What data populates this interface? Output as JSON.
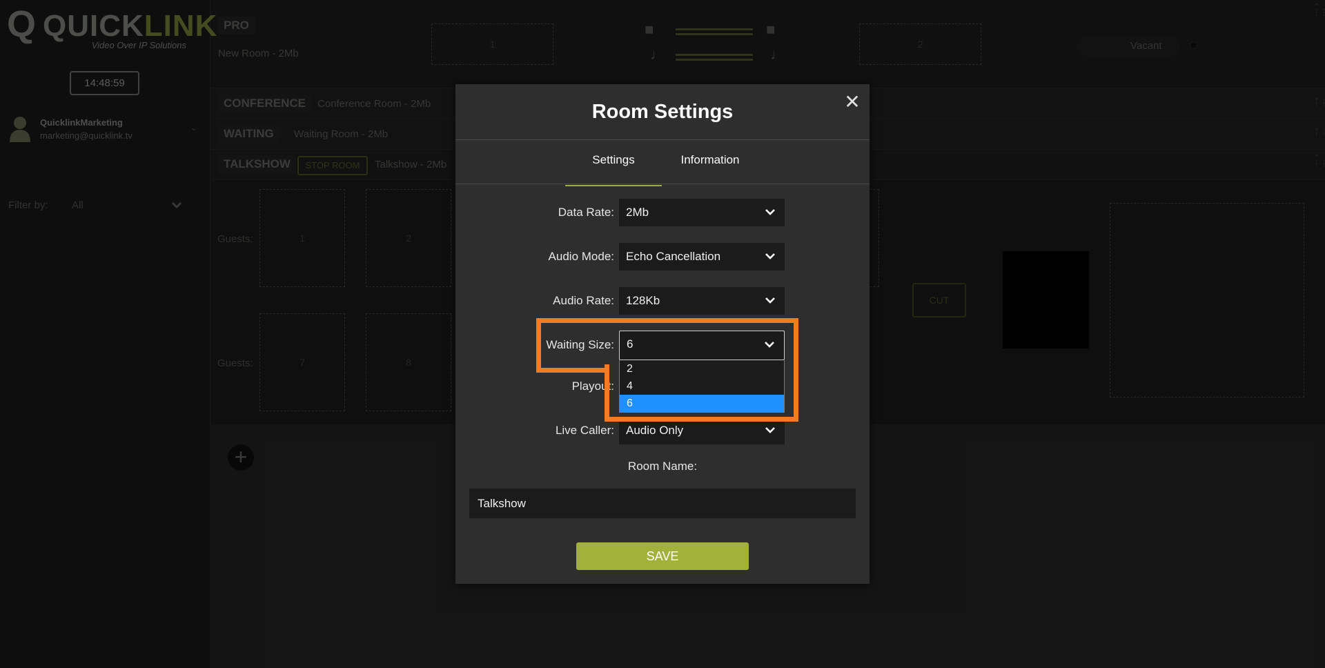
{
  "app": {
    "logo_mark": "Q",
    "logo_quick": "QUICK",
    "logo_link": "LINK",
    "logo_tagline": "Video Over IP Solutions",
    "clock": "14:48:59",
    "user_name": "QuicklinkMarketing",
    "user_email": "marketing@quicklink.tv",
    "filter_label": "Filter by:",
    "filter_value": "All"
  },
  "rooms": {
    "pro": {
      "badge": "PRO",
      "subtitle": "New Room - 2Mb",
      "slot1": "1",
      "slot2": "2",
      "status": "Vacant"
    },
    "conference": {
      "badge": "CONFERENCE",
      "subtitle": "Conference Room - 2Mb"
    },
    "waiting": {
      "badge": "WAITING",
      "subtitle": "Waiting Room - 2Mb"
    },
    "talkshow": {
      "badge": "TALKSHOW",
      "stop_label": "STOP ROOM",
      "subtitle": "Talkshow - 2Mb",
      "guests_label": "Guests:",
      "slots_row1": [
        "1",
        "2"
      ],
      "slots_row2": [
        "7",
        "8"
      ],
      "cut_label": "CUT"
    }
  },
  "modal": {
    "title": "Room Settings",
    "close_glyph": "✕",
    "tabs": [
      {
        "label": "Settings",
        "active": true
      },
      {
        "label": "Information",
        "active": false
      }
    ],
    "fields": {
      "data_rate": {
        "label": "Data Rate:",
        "value": "2Mb"
      },
      "audio_mode": {
        "label": "Audio Mode:",
        "value": "Echo Cancellation"
      },
      "audio_rate": {
        "label": "Audio Rate:",
        "value": "128Kb"
      },
      "waiting_size": {
        "label": "Waiting Size:",
        "value": "6",
        "options": [
          "2",
          "4",
          "6"
        ]
      },
      "playout": {
        "label": "Playout:"
      },
      "live_caller": {
        "label": "Live Caller:",
        "value": "Audio Only"
      }
    },
    "room_name_label": "Room Name:",
    "room_name_value": "Talkshow",
    "save_label": "SAVE"
  },
  "colors": {
    "accent": "#a1b13a",
    "highlight": "#f07d23",
    "selected_option": "#1e90ff",
    "modal_bg": "#2e2e2e"
  }
}
